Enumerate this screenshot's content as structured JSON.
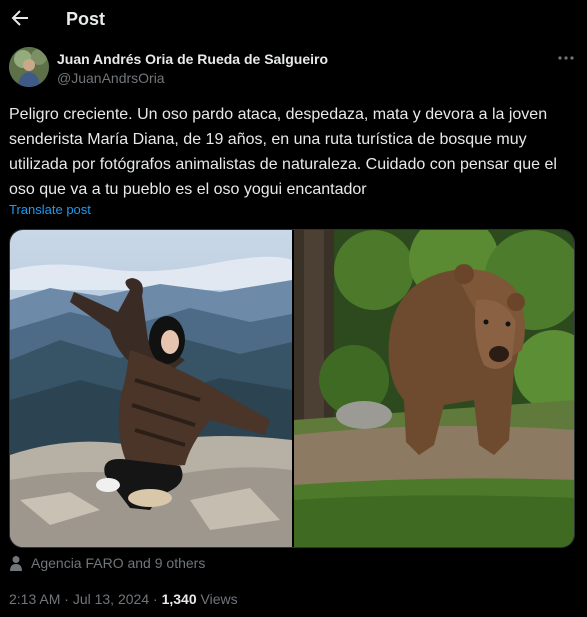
{
  "header": {
    "title": "Post",
    "back_icon": "arrow-left-icon"
  },
  "author": {
    "name": "Juan Andrés Oria de Rueda de Salgueiro",
    "handle": "@JuanAndrsOria",
    "more_icon": "ellipsis-icon"
  },
  "post": {
    "text": "Peligro creciente. Un oso pardo ataca, despedaza, mata y devora a la joven senderista María Diana, de 19 años, en una ruta turística de bosque muy utilizada por fotógrafos animalistas de naturaleza. Cuidado con pensar que el oso que va a tu pueblo es el oso yogui encantador",
    "translate_label": "Translate post"
  },
  "media": {
    "photos": [
      "woman-on-mountain-photo",
      "brown-bear-photo"
    ]
  },
  "engagement": {
    "liked_by": "Agencia FARO and 9 others",
    "icon": "person-icon"
  },
  "meta": {
    "time": "2:13 AM",
    "separator": "·",
    "date": "Jul 13, 2024",
    "views_count": "1,340",
    "views_label": "Views"
  },
  "colors": {
    "background": "#000000",
    "text": "#e7e9ea",
    "muted": "#71767b",
    "link": "#1d9bf0"
  }
}
